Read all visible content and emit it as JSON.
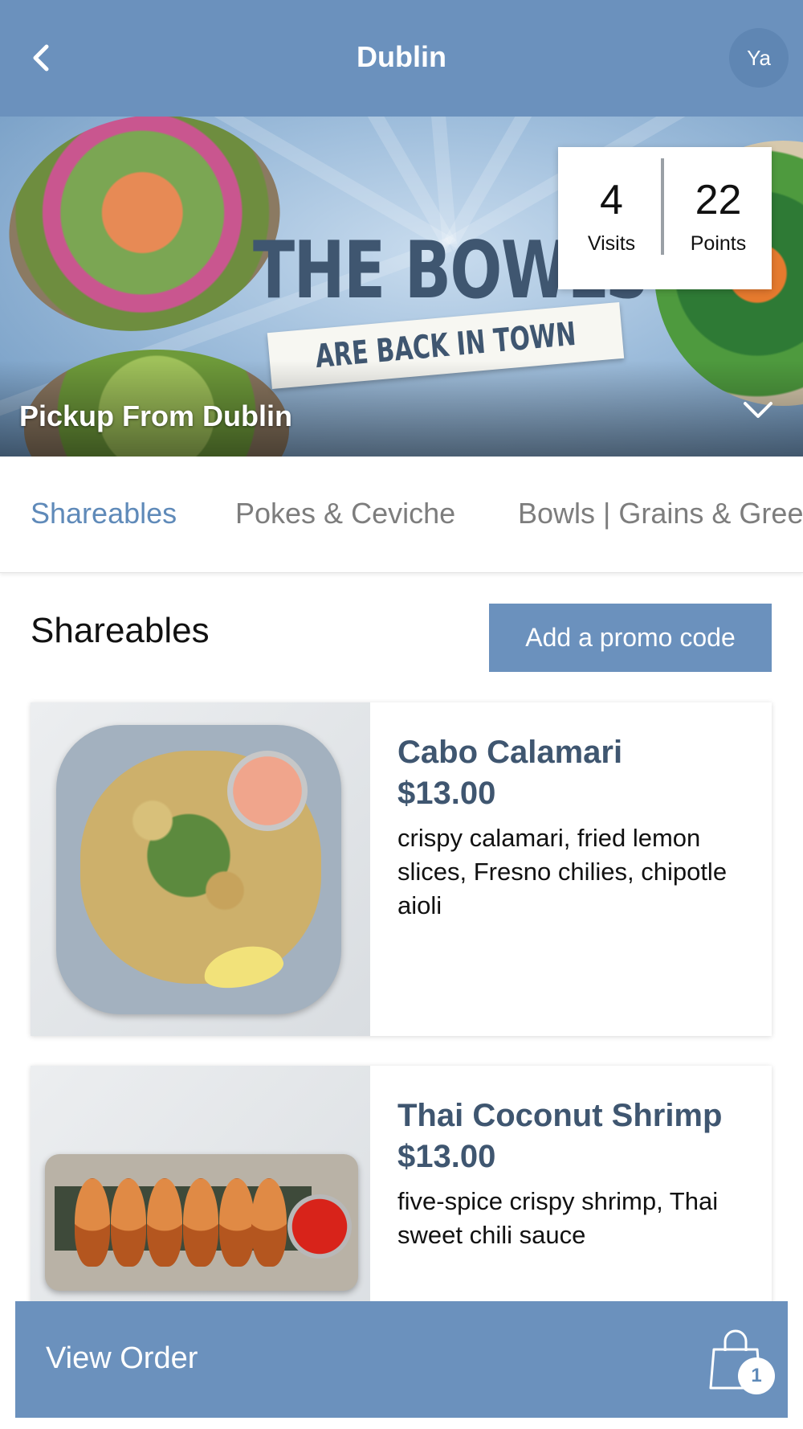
{
  "header": {
    "title": "Dublin",
    "avatar_initials": "Ya"
  },
  "hero": {
    "headline": "THE BOWLS",
    "ribbon": "ARE BACK IN TOWN",
    "pickup_label": "Pickup From Dublin",
    "stats": {
      "visits_value": "4",
      "visits_label": "Visits",
      "points_value": "22",
      "points_label": "Points"
    }
  },
  "tabs": [
    {
      "label": "Shareables",
      "active": true
    },
    {
      "label": "Pokes & Ceviche",
      "active": false
    },
    {
      "label": "Bowls | Grains & Greens",
      "active": false
    }
  ],
  "section": {
    "title": "Shareables",
    "promo_button": "Add a promo code"
  },
  "items": [
    {
      "name": "Cabo Calamari",
      "price": "$13.00",
      "description": "crispy calamari, fried lemon slices, Fresno chilies, chipotle aioli"
    },
    {
      "name": "Thai Coconut Shrimp",
      "price": "$13.00",
      "description": "five-spice crispy shrimp, Thai sweet chili sauce"
    }
  ],
  "order_bar": {
    "label": "View Order",
    "cart_count": "1"
  },
  "colors": {
    "brand_blue": "#6b91bd",
    "item_text": "#3f5670",
    "active_tab": "#5f8ab9",
    "inactive_tab": "#7d7d7d"
  },
  "icons": {
    "back": "chevron-left-icon",
    "pickup_toggle": "chevron-down-icon",
    "cart": "shopping-bag-icon"
  }
}
